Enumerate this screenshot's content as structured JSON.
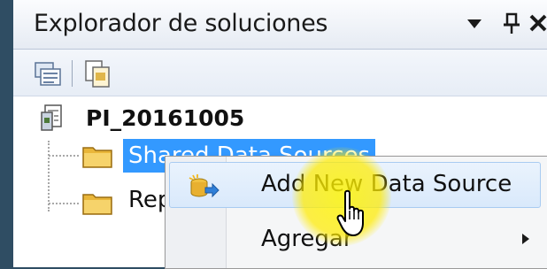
{
  "window": {
    "title": "Explorador de soluciones"
  },
  "colors": {
    "selection": "#3399ff",
    "background": "#2f4d63",
    "highlight": "#ffee00"
  },
  "titlebar_buttons": [
    "dropdown-arrow-icon",
    "pin-icon",
    "close-icon"
  ],
  "toolbar": {
    "icons": [
      "properties-icon",
      "show-all-files-icon"
    ]
  },
  "tree": {
    "root": "PI_20161005",
    "items": [
      {
        "label": "Shared Data Sources",
        "selected": true
      },
      {
        "label": "Repo"
      }
    ]
  },
  "context_menu": {
    "items": [
      {
        "label": "Add New Data Source",
        "icon": "add-data-source-icon",
        "hovered": true
      },
      {
        "label": "Agregar",
        "submenu": true
      }
    ]
  }
}
